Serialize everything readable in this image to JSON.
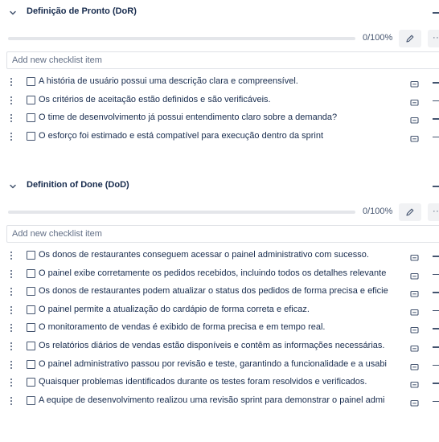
{
  "sections": [
    {
      "title": "Definição de Pronto (DoR)",
      "progress_text": "0/100%",
      "progress_value": 0,
      "add_placeholder": "Add new checklist item",
      "items": [
        "A história de usuário possui uma descrição clara e compreensível.",
        "Os critérios de aceitação estão definidos e são verificáveis.",
        "O time de desenvolvimento já possui entendimento claro sobre a demanda?",
        "O esforço foi estimado e está compatível para execução dentro da sprint"
      ]
    },
    {
      "title": "Definition of Done (DoD)",
      "progress_text": "0/100%",
      "progress_value": 0,
      "add_placeholder": "Add new checklist item",
      "items": [
        "Os donos de restaurantes conseguem acessar o painel administrativo com sucesso.",
        "O painel exibe corretamente os pedidos recebidos, incluindo todos os detalhes relevante",
        "Os donos de restaurantes podem atualizar o status dos pedidos de forma precisa e eficie",
        "O painel permite a atualização do cardápio de forma correta e eficaz.",
        "O monitoramento de vendas é exibido de forma precisa e em tempo real.",
        "Os relatórios diários de vendas estão disponíveis e contêm as informações necessárias.",
        "O painel administrativo passou por revisão e teste, garantindo a funcionalidade e a usabi",
        "Quaisquer problemas identificados durante os testes foram resolvidos e verificados.",
        "A equipe de desenvolvimento realizou uma revisão sprint para demonstrar o painel admi"
      ]
    }
  ],
  "icons": {
    "chevron": "chevron-down-icon",
    "edit": "pencil-icon",
    "more": "more-icon",
    "drag": "drag-handle-icon",
    "comment": "comment-icon"
  },
  "more_label": "···",
  "colors": {
    "text": "#172b4d",
    "muted": "#44546f",
    "track": "#e4e6ea",
    "button_bg": "#f1f2f4"
  }
}
